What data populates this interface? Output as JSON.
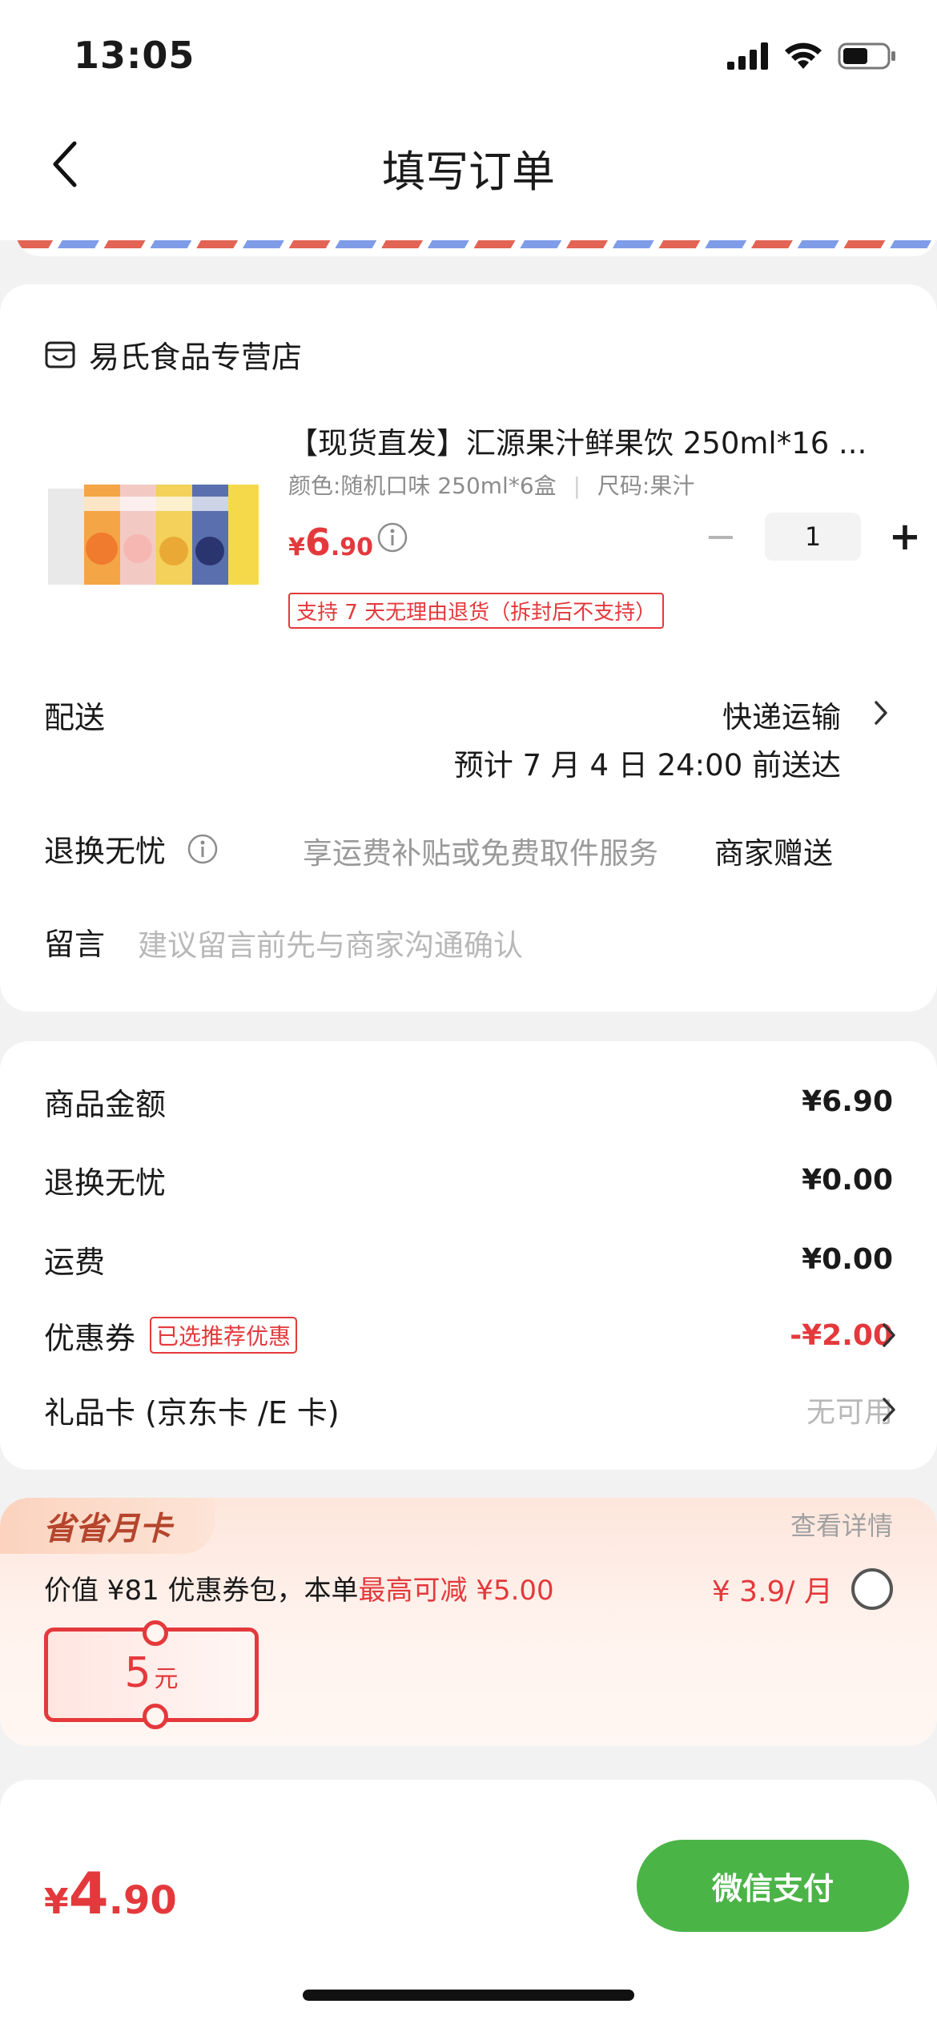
{
  "status_bar": {
    "time": "13:05"
  },
  "nav": {
    "title": "填写订单"
  },
  "colors": {
    "accent_red": "#e4393c",
    "pay_green": "#4bb447",
    "airmail_red": "#e36455",
    "airmail_blue": "#7f9ce8"
  },
  "store": {
    "name": "易氏食品专营店",
    "icon": "store-icon"
  },
  "product": {
    "title": "【现货直发】汇源果汁鲜果饮 250ml*16 ...",
    "spec_color": "颜色:随机口味 250ml*6盒",
    "spec_size": "尺码:果汁",
    "price_yen": "¥",
    "price_int": "6",
    "price_dec": ".90",
    "quantity": "1",
    "return_tag": "支持 7 天无理由退货（拆封后不支持）"
  },
  "delivery": {
    "label": "配送",
    "method": "快递运输",
    "eta": "预计 7 月 4 日 24:00 前送达"
  },
  "exchange": {
    "label": "退换无忧",
    "desc": "享运费补贴或免费取件服务",
    "value": "商家赠送"
  },
  "message": {
    "label": "留言",
    "placeholder": "建议留言前先与商家沟通确认"
  },
  "summary": {
    "items": [
      {
        "label": "商品金额",
        "value": "¥6.90"
      },
      {
        "label": "退换无忧",
        "value": "¥0.00"
      },
      {
        "label": "运费",
        "value": "¥0.00"
      }
    ],
    "coupon": {
      "label": "优惠券",
      "tag": "已选推荐优惠",
      "value": "-¥2.00"
    },
    "giftcard": {
      "label": "礼品卡 (京东卡 /E 卡)",
      "value": "无可用"
    }
  },
  "member_card": {
    "badge": "省省月卡",
    "detail_link": "查看详情",
    "desc_prefix": "价值 ¥81 优惠券包，本单",
    "desc_highlight": "最高可减 ¥5.00",
    "price": "¥ 3.9/ 月",
    "voucher_num": "5",
    "voucher_unit": "元"
  },
  "bottom": {
    "total_yen": "¥",
    "total_int": "4",
    "total_dec": ".90",
    "pay_label": "微信支付"
  }
}
